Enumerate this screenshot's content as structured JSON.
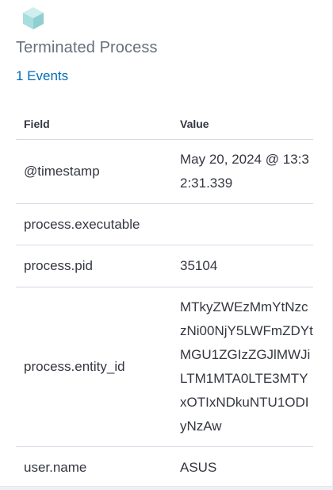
{
  "header": {
    "icon": "cube-icon",
    "title": "Terminated Process",
    "events_link": "1 Events"
  },
  "table": {
    "columns": [
      "Field",
      "Value"
    ],
    "rows": [
      {
        "field": "@timestamp",
        "value": "May 20, 2024 @ 13:32:31.339"
      },
      {
        "field": "process.executable",
        "value": ""
      },
      {
        "field": "process.pid",
        "value": "35104"
      },
      {
        "field": "process.entity_id",
        "value": "MTkyZWEzMmYtNzczNi00NjY5LWFmZDYtMGU1ZGIzZGJlMWJiLTM1MTA0LTE3MTYxOTIxNDkuNTU1ODIyNzAw"
      },
      {
        "field": "user.name",
        "value": "ASUS"
      }
    ]
  },
  "colors": {
    "link": "#006bb8",
    "title": "#69707d",
    "cube_top": "#cfeeee",
    "cube_left": "#a8dede",
    "cube_right": "#8fcfd1"
  }
}
